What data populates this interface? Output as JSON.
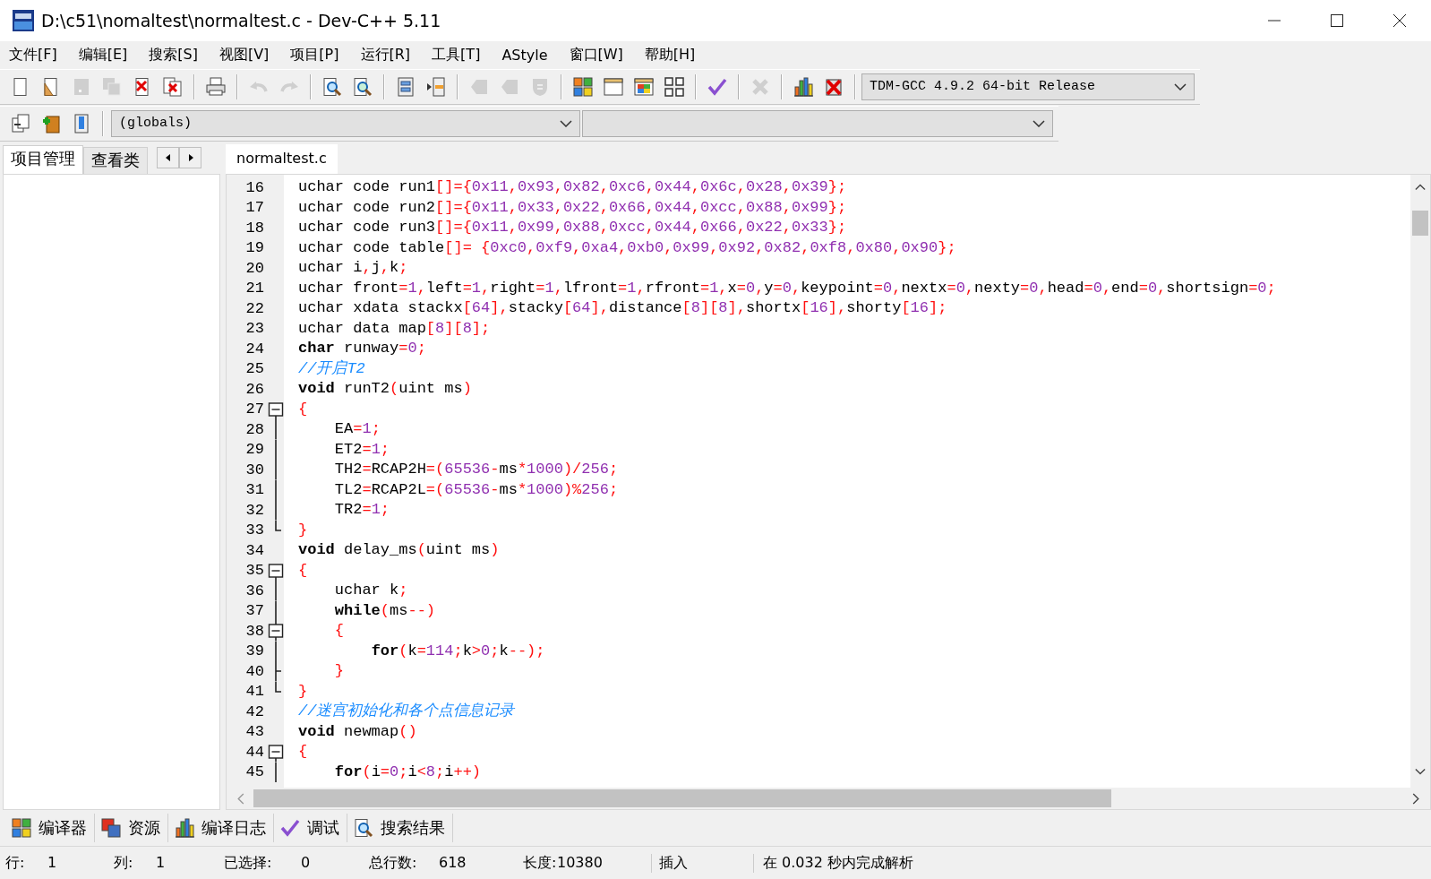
{
  "window": {
    "title": "D:\\c51\\nomaltest\\normaltest.c - Dev-C++ 5.11"
  },
  "menu": [
    "文件[F]",
    "编辑[E]",
    "搜索[S]",
    "视图[V]",
    "项目[P]",
    "运行[R]",
    "工具[T]",
    "AStyle",
    "窗口[W]",
    "帮助[H]"
  ],
  "toolbar": [
    {
      "disabled": false
    },
    {
      "disabled": false
    },
    {
      "disabled": true
    },
    {
      "disabled": true
    },
    {
      "disabled": false
    },
    {
      "disabled": false
    },
    {
      "disabled": false
    },
    {
      "disabled": true
    },
    {
      "disabled": true
    },
    {
      "disabled": false
    },
    {
      "disabled": false
    },
    {
      "disabled": false
    },
    {
      "disabled": false
    },
    {
      "disabled": true
    },
    {
      "disabled": true
    },
    {
      "disabled": true
    },
    {
      "disabled": false
    },
    {
      "disabled": false
    },
    {
      "disabled": false
    },
    {
      "disabled": false
    },
    {
      "disabled": false
    },
    {
      "disabled": true
    },
    {
      "disabled": false
    },
    {
      "disabled": false
    }
  ],
  "compiler_select": {
    "value": "TDM-GCC 4.9.2 64-bit Release"
  },
  "scope_select": {
    "value": "(globals)"
  },
  "side_tabs": [
    {
      "label": "项目管理",
      "selected": true
    },
    {
      "label": "查看类",
      "selected": false
    }
  ],
  "editor_tabs": [
    {
      "label": "normaltest.c",
      "selected": true
    }
  ],
  "code_lines": [
    {
      "number": "16",
      "kind": "code",
      "collapsible": false,
      "in_block": false,
      "block_end": false,
      "text": "uchar code run1[]={0x11,0x93,0x82,0xc6,0x44,0x6c,0x28,0x39};"
    },
    {
      "number": "17",
      "kind": "code",
      "collapsible": false,
      "in_block": false,
      "block_end": false,
      "text": "uchar code run2[]={0x11,0x33,0x22,0x66,0x44,0xcc,0x88,0x99};"
    },
    {
      "number": "18",
      "kind": "code",
      "collapsible": false,
      "in_block": false,
      "block_end": false,
      "text": "uchar code run3[]={0x11,0x99,0x88,0xcc,0x44,0x66,0x22,0x33};"
    },
    {
      "number": "19",
      "kind": "code",
      "collapsible": false,
      "in_block": false,
      "block_end": false,
      "text": "uchar code table[]= {0xc0,0xf9,0xa4,0xb0,0x99,0x92,0x82,0xf8,0x80,0x90};"
    },
    {
      "number": "20",
      "kind": "code",
      "collapsible": false,
      "in_block": false,
      "block_end": false,
      "text": "uchar i,j,k;"
    },
    {
      "number": "21",
      "kind": "code",
      "collapsible": false,
      "in_block": false,
      "block_end": false,
      "text": "uchar front=1,left=1,right=1,lfront=1,rfront=1,x=0,y=0,keypoint=0,nextx=0,nexty=0,head=0,end=0,shortsign=0;"
    },
    {
      "number": "22",
      "kind": "code",
      "collapsible": false,
      "in_block": false,
      "block_end": false,
      "text": "uchar xdata stackx[64],stacky[64],distance[8][8],shortx[16],shorty[16];"
    },
    {
      "number": "23",
      "kind": "code",
      "collapsible": false,
      "in_block": false,
      "block_end": false,
      "text": "uchar data map[8][8];"
    },
    {
      "number": "24",
      "kind": "code",
      "collapsible": false,
      "in_block": false,
      "block_end": false,
      "text": "**char** runway=0;"
    },
    {
      "number": "25",
      "kind": "comment",
      "collapsible": false,
      "in_block": false,
      "block_end": false,
      "text": "//开启T2"
    },
    {
      "number": "26",
      "kind": "code",
      "collapsible": false,
      "in_block": false,
      "block_end": false,
      "text": "**void** runT2(uint ms)"
    },
    {
      "number": "27",
      "kind": "code",
      "collapsible": true,
      "in_block": false,
      "block_end": false,
      "text": "{"
    },
    {
      "number": "28",
      "kind": "code",
      "collapsible": false,
      "in_block": true,
      "block_end": false,
      "text": "    EA=1;"
    },
    {
      "number": "29",
      "kind": "code",
      "collapsible": false,
      "in_block": true,
      "block_end": false,
      "text": "    ET2=1;"
    },
    {
      "number": "30",
      "kind": "code",
      "collapsible": false,
      "in_block": true,
      "block_end": false,
      "text": "    TH2=RCAP2H=(65536-ms*1000)/256;"
    },
    {
      "number": "31",
      "kind": "code",
      "collapsible": false,
      "in_block": true,
      "block_end": false,
      "text": "    TL2=RCAP2L=(65536-ms*1000)%256;"
    },
    {
      "number": "32",
      "kind": "code",
      "collapsible": false,
      "in_block": true,
      "block_end": false,
      "text": "    TR2=1;"
    },
    {
      "number": "33",
      "kind": "code",
      "collapsible": false,
      "in_block": false,
      "block_end": true,
      "text": "}"
    },
    {
      "number": "34",
      "kind": "code",
      "collapsible": false,
      "in_block": false,
      "block_end": false,
      "text": "**void** delay_ms(uint ms)"
    },
    {
      "number": "35",
      "kind": "code",
      "collapsible": true,
      "in_block": false,
      "block_end": false,
      "text": "{"
    },
    {
      "number": "36",
      "kind": "code",
      "collapsible": false,
      "in_block": true,
      "block_end": false,
      "text": "    uchar k;"
    },
    {
      "number": "37",
      "kind": "code",
      "collapsible": false,
      "in_block": true,
      "block_end": false,
      "text": "    **while**(ms--)"
    },
    {
      "number": "38",
      "kind": "code",
      "collapsible": true,
      "in_block": true,
      "block_end": false,
      "text": "    {"
    },
    {
      "number": "39",
      "kind": "code",
      "collapsible": false,
      "in_block": true,
      "block_end": false,
      "text": "        **for**(k=114;k>0;k--);"
    },
    {
      "number": "40",
      "kind": "code",
      "collapsible": false,
      "in_block": true,
      "block_end": true,
      "text": "    }"
    },
    {
      "number": "41",
      "kind": "code",
      "collapsible": false,
      "in_block": false,
      "block_end": true,
      "text": "}"
    },
    {
      "number": "42",
      "kind": "comment",
      "collapsible": false,
      "in_block": false,
      "block_end": false,
      "text": "//迷宫初始化和各个点信息记录"
    },
    {
      "number": "43",
      "kind": "code",
      "collapsible": false,
      "in_block": false,
      "block_end": false,
      "text": "**void** newmap()"
    },
    {
      "number": "44",
      "kind": "code",
      "collapsible": true,
      "in_block": false,
      "block_end": false,
      "text": "{"
    },
    {
      "number": "45",
      "kind": "code",
      "collapsible": false,
      "in_block": true,
      "block_end": false,
      "text": "    **for**(i=0;i<8;i++)"
    }
  ],
  "bottom_tabs": [
    {
      "label": "编译器"
    },
    {
      "label": "资源"
    },
    {
      "label": "编译日志"
    },
    {
      "label": "调试"
    },
    {
      "label": "搜索结果"
    }
  ],
  "status_bar": {
    "fields": [
      {
        "label": "行:",
        "value": "1"
      },
      {
        "label": "列:",
        "value": "1"
      },
      {
        "label": "已选择:",
        "value": "0"
      },
      {
        "label": "总行数:",
        "value": "618"
      },
      {
        "label": "长度:",
        "value": "10380"
      }
    ],
    "mode": "插入",
    "message": "在 0.032 秒内完成解析"
  }
}
